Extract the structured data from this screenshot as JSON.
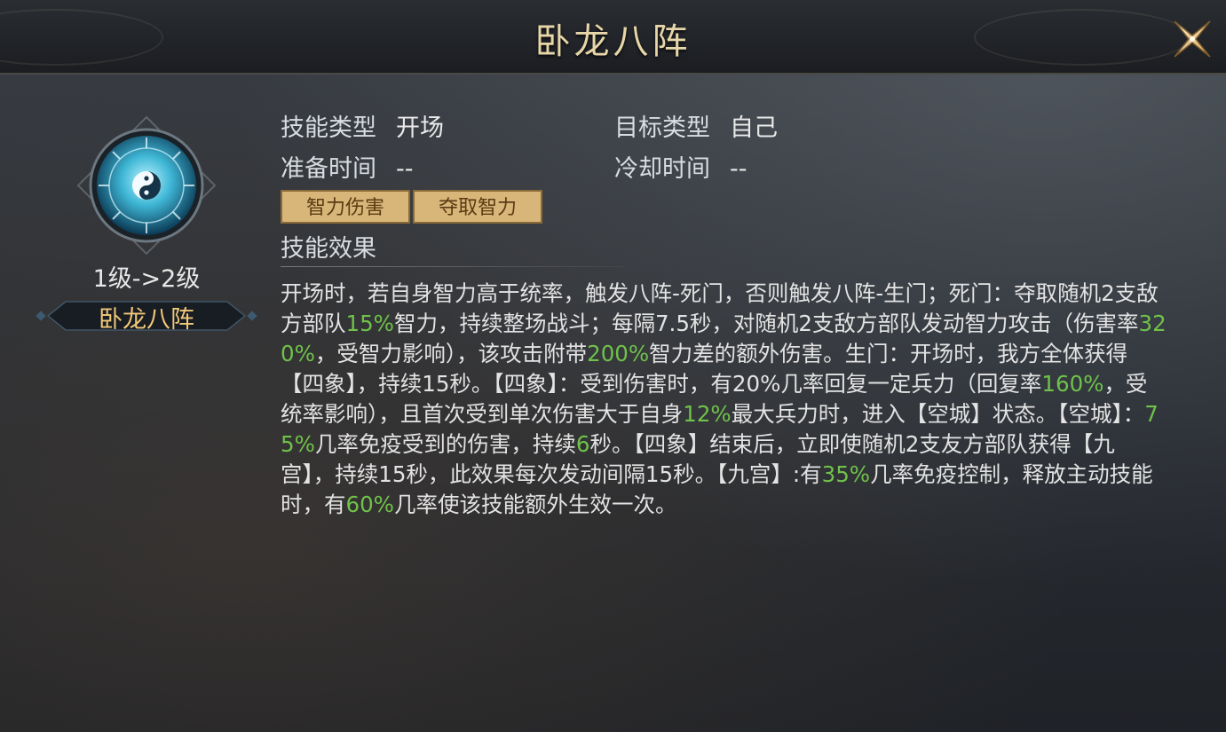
{
  "window": {
    "title": "卧龙八阵"
  },
  "skill": {
    "level_change": "1级->2级",
    "name": "卧龙八阵",
    "icon": "yin-yang-bagua-icon"
  },
  "info": {
    "type_label": "技能类型",
    "type_value": "开场",
    "target_label": "目标类型",
    "target_value": "自己",
    "prep_label": "准备时间",
    "prep_value": "--",
    "cooldown_label": "冷却时间",
    "cooldown_value": "--"
  },
  "tags": [
    "智力伤害",
    "夺取智力"
  ],
  "effect": {
    "title": "技能效果",
    "segments": [
      "开场时，若自身智力高于统率，触发八阵-死门，否则触发八阵-生门；死门：夺取随机2支敌方部队",
      "15%",
      "智力，持续整场战斗；每隔7.5秒，对随机2支敌方部队发动智力攻击（伤害率",
      "320%",
      "，受智力影响），该攻击附带",
      "200%",
      "智力差的额外伤害。生门：开场时，我方全体获得【四象】，持续15秒。【四象】：受到伤害时，有20%几率回复一定兵力（回复率",
      "160%",
      "，受统率影响），且首次受到单次伤害大于自身",
      "12%",
      "最大兵力时，进入【空城】状态。【空城】：",
      "75%",
      "几率免疫受到的伤害，持续",
      "6",
      "秒。【四象】结束后，立即使随机2支友方部队获得【九宫】，持续15秒，此效果每次发动间隔15秒。【九宫】:有",
      "35%",
      "几率免疫控制，释放主动技能时，有",
      "60%",
      "几率使该技能额外生效一次。"
    ]
  },
  "colors": {
    "highlight": "#6fc24a",
    "title_gold": "#e7d6a8",
    "name_gold": "#f1c878",
    "tag_bg": "#d8b67a"
  }
}
